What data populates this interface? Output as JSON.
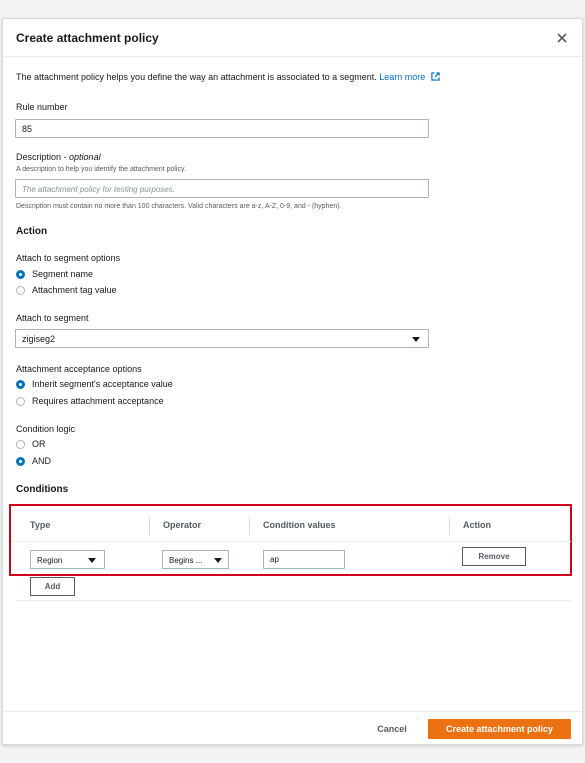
{
  "modal": {
    "title": "Create attachment policy",
    "intro_text": "The attachment policy helps you define the way an attachment is associated to a segment.",
    "learn_more": "Learn more"
  },
  "rule_number": {
    "label": "Rule number",
    "value": "85"
  },
  "description": {
    "label": "Description",
    "optional": "- optional",
    "hint": "A description to help you identify the attachment policy.",
    "placeholder": "The attachment policy for testing purposes.",
    "constraint": "Description must contain no more than 100 characters. Valid characters are a-z, A-Z, 0-9, and - (hyphen)."
  },
  "action": {
    "section_title": "Action",
    "segment_options": {
      "label": "Attach to segment options",
      "options": [
        "Segment name",
        "Attachment tag value"
      ],
      "selected": "Segment name"
    },
    "attach_to_segment": {
      "label": "Attach to segment",
      "value": "zigiseg2"
    },
    "acceptance_options": {
      "label": "Attachment acceptance options",
      "options": [
        "Inherit segment's acceptance value",
        "Requires attachment acceptance"
      ],
      "selected": "Inherit segment's acceptance value"
    },
    "condition_logic": {
      "label": "Condition logic",
      "options": [
        "OR",
        "AND"
      ],
      "selected": "AND"
    }
  },
  "conditions": {
    "section_title": "Conditions",
    "columns": [
      "Type",
      "Operator",
      "Condition values",
      "Action"
    ],
    "rows": [
      {
        "type": "Region",
        "operator": "Begins ...",
        "value": "ap",
        "action": "Remove"
      }
    ],
    "add_label": "Add"
  },
  "footer": {
    "cancel": "Cancel",
    "submit": "Create attachment policy"
  },
  "colors": {
    "primary": "#ec7211",
    "link": "#0073bb",
    "highlight_border": "#d0021b"
  }
}
